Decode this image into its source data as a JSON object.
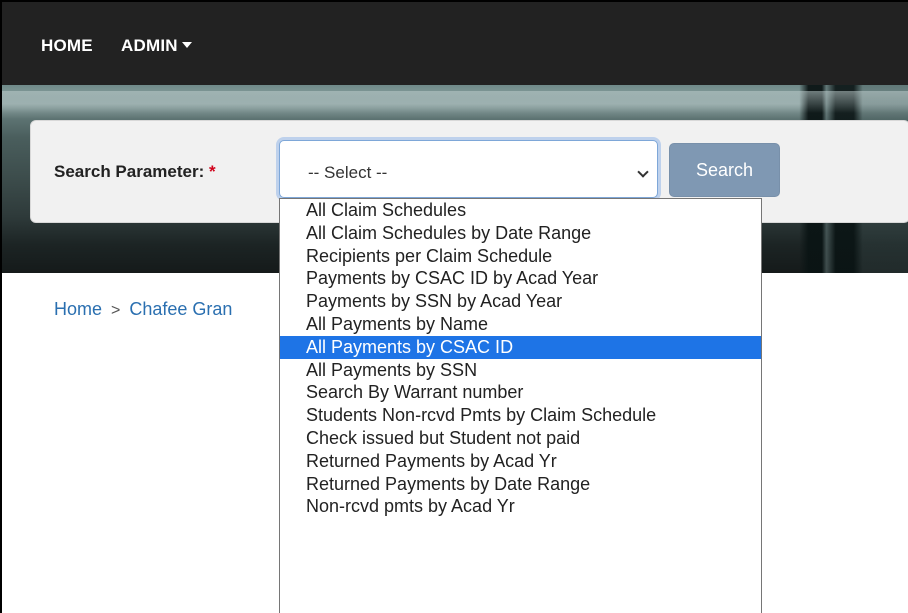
{
  "nav": {
    "home": "HOME",
    "admin": "ADMIN"
  },
  "search": {
    "label": "Search Parameter:",
    "required_mark": "*",
    "selected_value": "-- Select --",
    "button": "Search"
  },
  "breadcrumb": {
    "home": "Home",
    "separator": ">",
    "current": "Chafee Gran"
  },
  "dropdown": {
    "selected_index": 6,
    "options": [
      "All Claim Schedules",
      "All Claim Schedules by Date Range",
      "Recipients per Claim Schedule",
      "Payments by CSAC ID by Acad Year",
      "Payments by SSN by Acad Year",
      "All Payments by Name",
      "All Payments by CSAC ID",
      "All Payments by SSN",
      "Search By Warrant number",
      "Students Non-rcvd Pmts by Claim Schedule",
      "Check issued but Student not paid",
      "Returned Payments by Acad Yr",
      "Returned Payments by Date Range",
      "Non-rcvd pmts by Acad Yr"
    ]
  },
  "colors": {
    "navbar": "#222222",
    "highlight": "#1e74e6",
    "button": "#7f98b3",
    "link": "#2a6fb0",
    "required": "#d0021b"
  }
}
